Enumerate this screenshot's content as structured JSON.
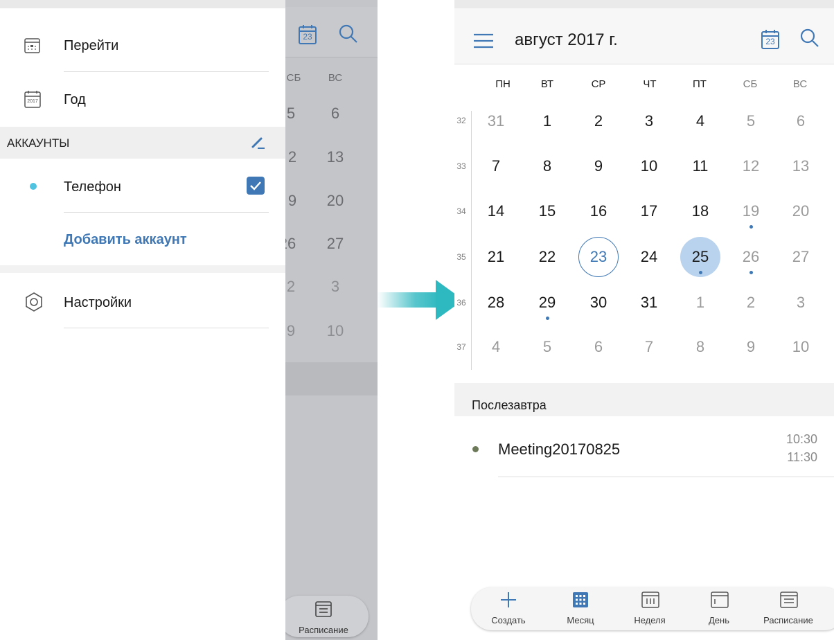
{
  "left": {
    "drawer": {
      "goto_label": "Перейти",
      "year_label": "Год",
      "year_icon_text": "2017",
      "accounts_header": "АККАУНТЫ",
      "phone_label": "Телефон",
      "add_account_label": "Добавить аккаунт",
      "settings_label": "Настройки",
      "account_dot_color": "#4fc3e0",
      "checkbox_color": "#3f78b5",
      "link_color": "#3f78b5"
    },
    "background_calendar": {
      "calendar_icon_text": "23",
      "day_headers": [
        "СБ",
        "ВС"
      ],
      "rows": [
        [
          "5",
          "6"
        ],
        [
          "2",
          "13"
        ],
        [
          "9",
          "20"
        ],
        [
          "26",
          "27"
        ],
        [
          "2",
          "3"
        ],
        [
          "9",
          "10"
        ]
      ],
      "bottom_tab_label": "Расписание"
    }
  },
  "right": {
    "header": {
      "title": "август 2017 г.",
      "calendar_icon_text": "23"
    },
    "weekdays": [
      "ПН",
      "ВТ",
      "СР",
      "ЧТ",
      "ПТ",
      "СБ",
      "ВС"
    ],
    "weeks": [
      {
        "num": "32",
        "days": [
          "31",
          "1",
          "2",
          "3",
          "4",
          "5",
          "6"
        ]
      },
      {
        "num": "33",
        "days": [
          "7",
          "8",
          "9",
          "10",
          "11",
          "12",
          "13"
        ]
      },
      {
        "num": "34",
        "days": [
          "14",
          "15",
          "16",
          "17",
          "18",
          "19",
          "20"
        ]
      },
      {
        "num": "35",
        "days": [
          "21",
          "22",
          "23",
          "24",
          "25",
          "26",
          "27"
        ]
      },
      {
        "num": "36",
        "days": [
          "28",
          "29",
          "30",
          "31",
          "1",
          "2",
          "3"
        ]
      },
      {
        "num": "37",
        "days": [
          "4",
          "5",
          "6",
          "7",
          "8",
          "9",
          "10"
        ]
      }
    ],
    "agenda": {
      "section_title": "Послезавтра",
      "event": {
        "title": "Meeting20170825",
        "start": "10:30",
        "end": "11:30",
        "color": "#6d7a5a"
      }
    },
    "bottom_nav": {
      "create_label": "Создать",
      "month_label": "Месяц",
      "week_label": "Неделя",
      "day_label": "День",
      "schedule_label": "Расписание"
    },
    "accent_color": "#3f78b5",
    "selected_fill": "#b9d3ee"
  }
}
